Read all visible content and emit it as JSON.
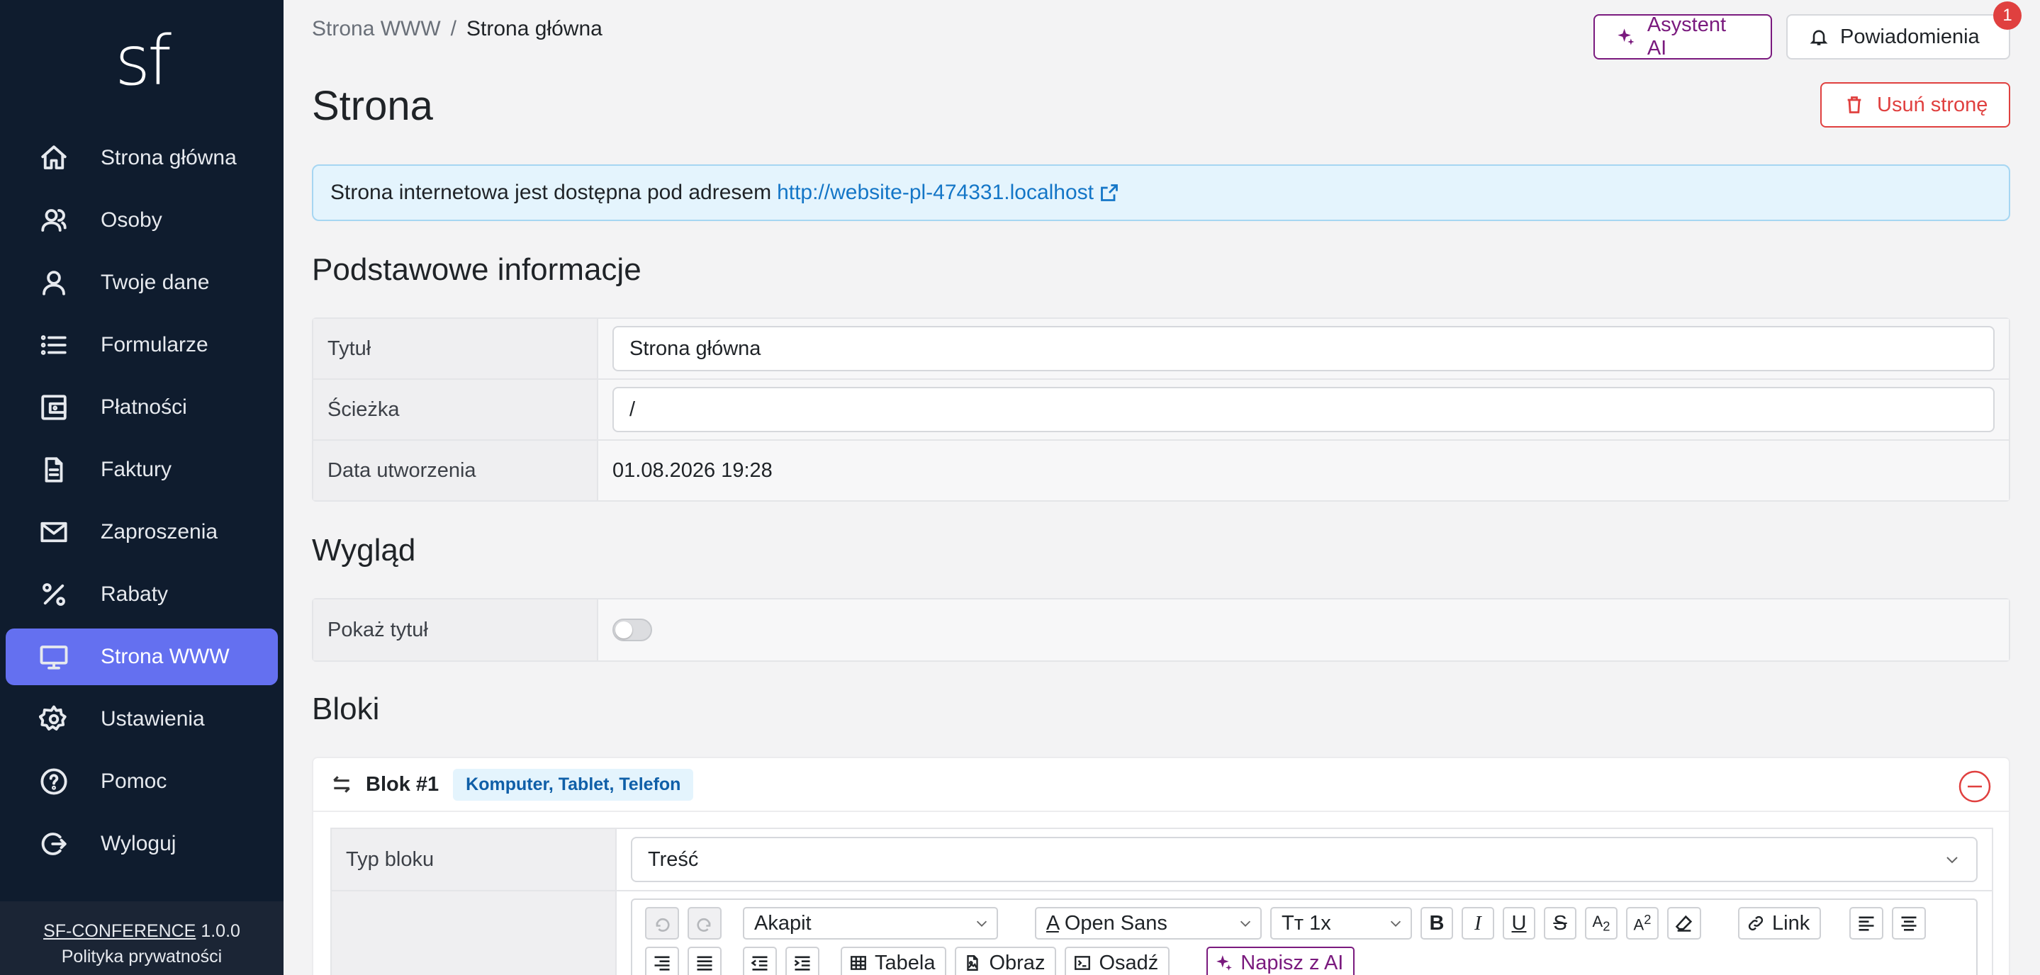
{
  "sidebar": {
    "logo": "sf",
    "items": [
      {
        "label": "Strona główna",
        "icon": "home-icon"
      },
      {
        "label": "Osoby",
        "icon": "users-icon"
      },
      {
        "label": "Twoje dane",
        "icon": "user-icon"
      },
      {
        "label": "Formularze",
        "icon": "list-icon"
      },
      {
        "label": "Płatności",
        "icon": "wallet-icon"
      },
      {
        "label": "Faktury",
        "icon": "file-icon"
      },
      {
        "label": "Zaproszenia",
        "icon": "mail-icon"
      },
      {
        "label": "Rabaty",
        "icon": "percent-icon"
      },
      {
        "label": "Strona WWW",
        "icon": "monitor-icon",
        "active": true
      },
      {
        "label": "Ustawienia",
        "icon": "gear-icon"
      },
      {
        "label": "Pomoc",
        "icon": "help-icon"
      },
      {
        "label": "Wyloguj",
        "icon": "logout-icon"
      }
    ],
    "footer": {
      "brand": "SF-CONFERENCE",
      "version": "1.0.0",
      "privacy": "Polityka prywatności"
    }
  },
  "header": {
    "breadcrumb": [
      "Strona WWW",
      "Strona główna"
    ],
    "breadcrumb_sep": "/",
    "ai_button": "Asystent AI",
    "notifications_button": "Powiadomienia",
    "notifications_count": "1"
  },
  "page": {
    "title": "Strona",
    "delete_button": "Usuń stronę",
    "info_text": "Strona internetowa jest dostępna pod adresem",
    "info_link": "http://website-pl-474331.localhost"
  },
  "basic_info": {
    "heading": "Podstawowe informacje",
    "title_label": "Tytuł",
    "title_value": "Strona główna",
    "path_label": "Ścieżka",
    "path_value": "/",
    "created_label": "Data utworzenia",
    "created_value": "01.08.2026 19:28"
  },
  "appearance": {
    "heading": "Wygląd",
    "show_title_label": "Pokaż tytuł",
    "show_title": false
  },
  "blocks": {
    "heading": "Bloki",
    "items": [
      {
        "title": "Blok #1",
        "devices": "Komputer, Tablet, Telefon",
        "type_label": "Typ bloku",
        "type_value": "Treść",
        "toolbar": {
          "paragraph": "Akapit",
          "font": "Open Sans",
          "size": "1x",
          "link": "Link",
          "table": "Tabela",
          "image": "Obraz",
          "embed": "Osadź",
          "ai_write": "Napisz z AI"
        }
      }
    ]
  },
  "colors": {
    "sidebar_bg": "#0f1c2e",
    "active_nav": "#6470f0",
    "ai_accent": "#7a1a7e",
    "danger": "#e0403f",
    "link": "#1476c7"
  }
}
